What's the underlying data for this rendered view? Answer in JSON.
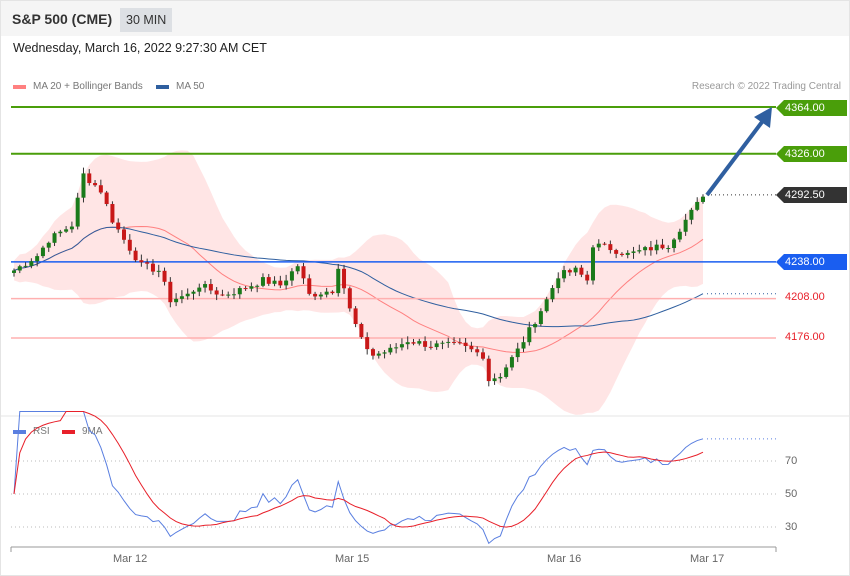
{
  "header": {
    "title": "S&P 500 (CME)",
    "timeframe": "30 MIN"
  },
  "date": "Wednesday, March 16, 2022 9:27:30 AM CET",
  "legend": {
    "bb": "MA 20 + Bollinger Bands",
    "ma50": "MA 50",
    "rsi": "RSI",
    "ma9": "9MA",
    "copyright": "Research © 2022 Trading Central"
  },
  "colors": {
    "green": "#4a9e0a",
    "blue": "#1a5ef0",
    "red": "#e8202a",
    "dark": "#333333",
    "bb": "#ff8080",
    "ma50": "#2f5f9f"
  },
  "chart_data": {
    "type": "candlestick",
    "levels": [
      {
        "label": "4364.00",
        "value": 4364,
        "kind": "resistance"
      },
      {
        "label": "4326.00",
        "value": 4326,
        "kind": "resistance"
      },
      {
        "label": "4292.50",
        "value": 4292.5,
        "kind": "last"
      },
      {
        "label": "4238.00",
        "value": 4238,
        "kind": "pivot"
      },
      {
        "label": "4208.00",
        "value": 4208,
        "kind": "support"
      },
      {
        "label": "4176.00",
        "value": 4176,
        "kind": "support"
      }
    ],
    "candles": 120,
    "close_waypoints": [
      [
        0,
        4231
      ],
      [
        4,
        4243
      ],
      [
        6,
        4256
      ],
      [
        10,
        4268
      ],
      [
        12,
        4309
      ],
      [
        15,
        4296
      ],
      [
        17,
        4272
      ],
      [
        19,
        4256
      ],
      [
        22,
        4235
      ],
      [
        25,
        4231
      ],
      [
        27,
        4207
      ],
      [
        30,
        4211
      ],
      [
        32,
        4219
      ],
      [
        36,
        4211
      ],
      [
        39,
        4215
      ],
      [
        43,
        4223
      ],
      [
        46,
        4219
      ],
      [
        49,
        4235
      ],
      [
        51,
        4211
      ],
      [
        55,
        4215
      ],
      [
        56,
        4235
      ],
      [
        58,
        4199
      ],
      [
        60,
        4174
      ],
      [
        62,
        4162
      ],
      [
        65,
        4166
      ],
      [
        68,
        4174
      ],
      [
        72,
        4170
      ],
      [
        77,
        4170
      ],
      [
        81,
        4162
      ],
      [
        82,
        4142
      ],
      [
        84,
        4146
      ],
      [
        87,
        4166
      ],
      [
        89,
        4182
      ],
      [
        92,
        4207
      ],
      [
        94,
        4227
      ],
      [
        97,
        4231
      ],
      [
        99,
        4223
      ],
      [
        100,
        4252
      ],
      [
        103,
        4249
      ],
      [
        106,
        4244
      ],
      [
        110,
        4249
      ],
      [
        113,
        4252
      ],
      [
        116,
        4272
      ],
      [
        119,
        4291
      ]
    ],
    "x_ticks": [
      "Mar 12",
      "Mar 15",
      "Mar 16",
      "Mar 17"
    ],
    "rsi_ticks": [
      "70",
      "50",
      "30"
    ],
    "rsi_ylim": [
      0,
      100
    ]
  }
}
